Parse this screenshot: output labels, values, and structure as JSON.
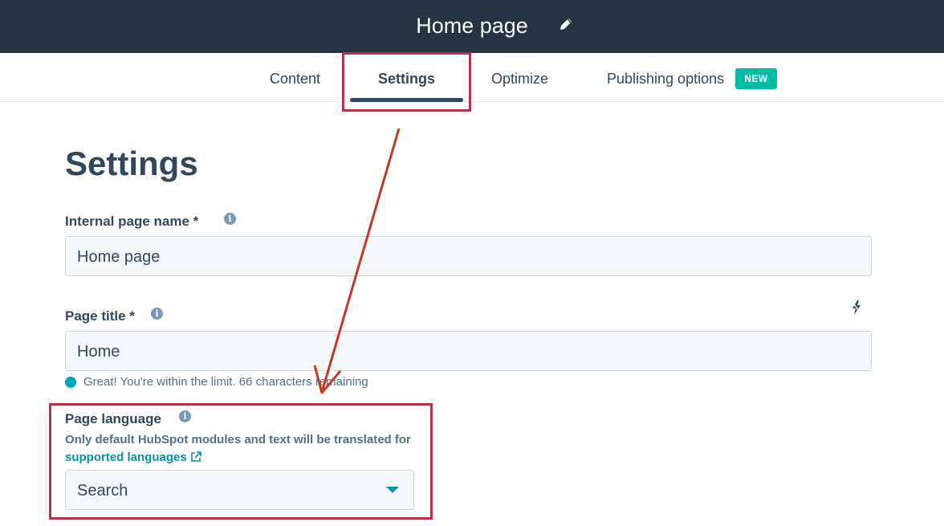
{
  "header": {
    "page_name": "Home page",
    "edit_icon": "pencil-icon"
  },
  "tabs": [
    {
      "label": "Content"
    },
    {
      "label": "Settings",
      "active": true
    },
    {
      "label": "Optimize"
    },
    {
      "label": "Publishing options",
      "badge": "NEW"
    }
  ],
  "settings": {
    "heading": "Settings",
    "internal_name": {
      "label": "Internal page name *",
      "value": "Home page"
    },
    "page_title": {
      "label": "Page title *",
      "value": "Home",
      "status": "Great! You're within the limit. 66 characters remaining"
    },
    "page_language": {
      "label": "Page language",
      "helper_text": "Only default HubSpot modules and text will be translated for",
      "helper_link": "supported languages",
      "select_value": "Search"
    }
  },
  "colors": {
    "topbar": "#253342",
    "accent_teal": "#00bda5",
    "annotation": "#b0334a",
    "arrow": "#c0392b"
  }
}
